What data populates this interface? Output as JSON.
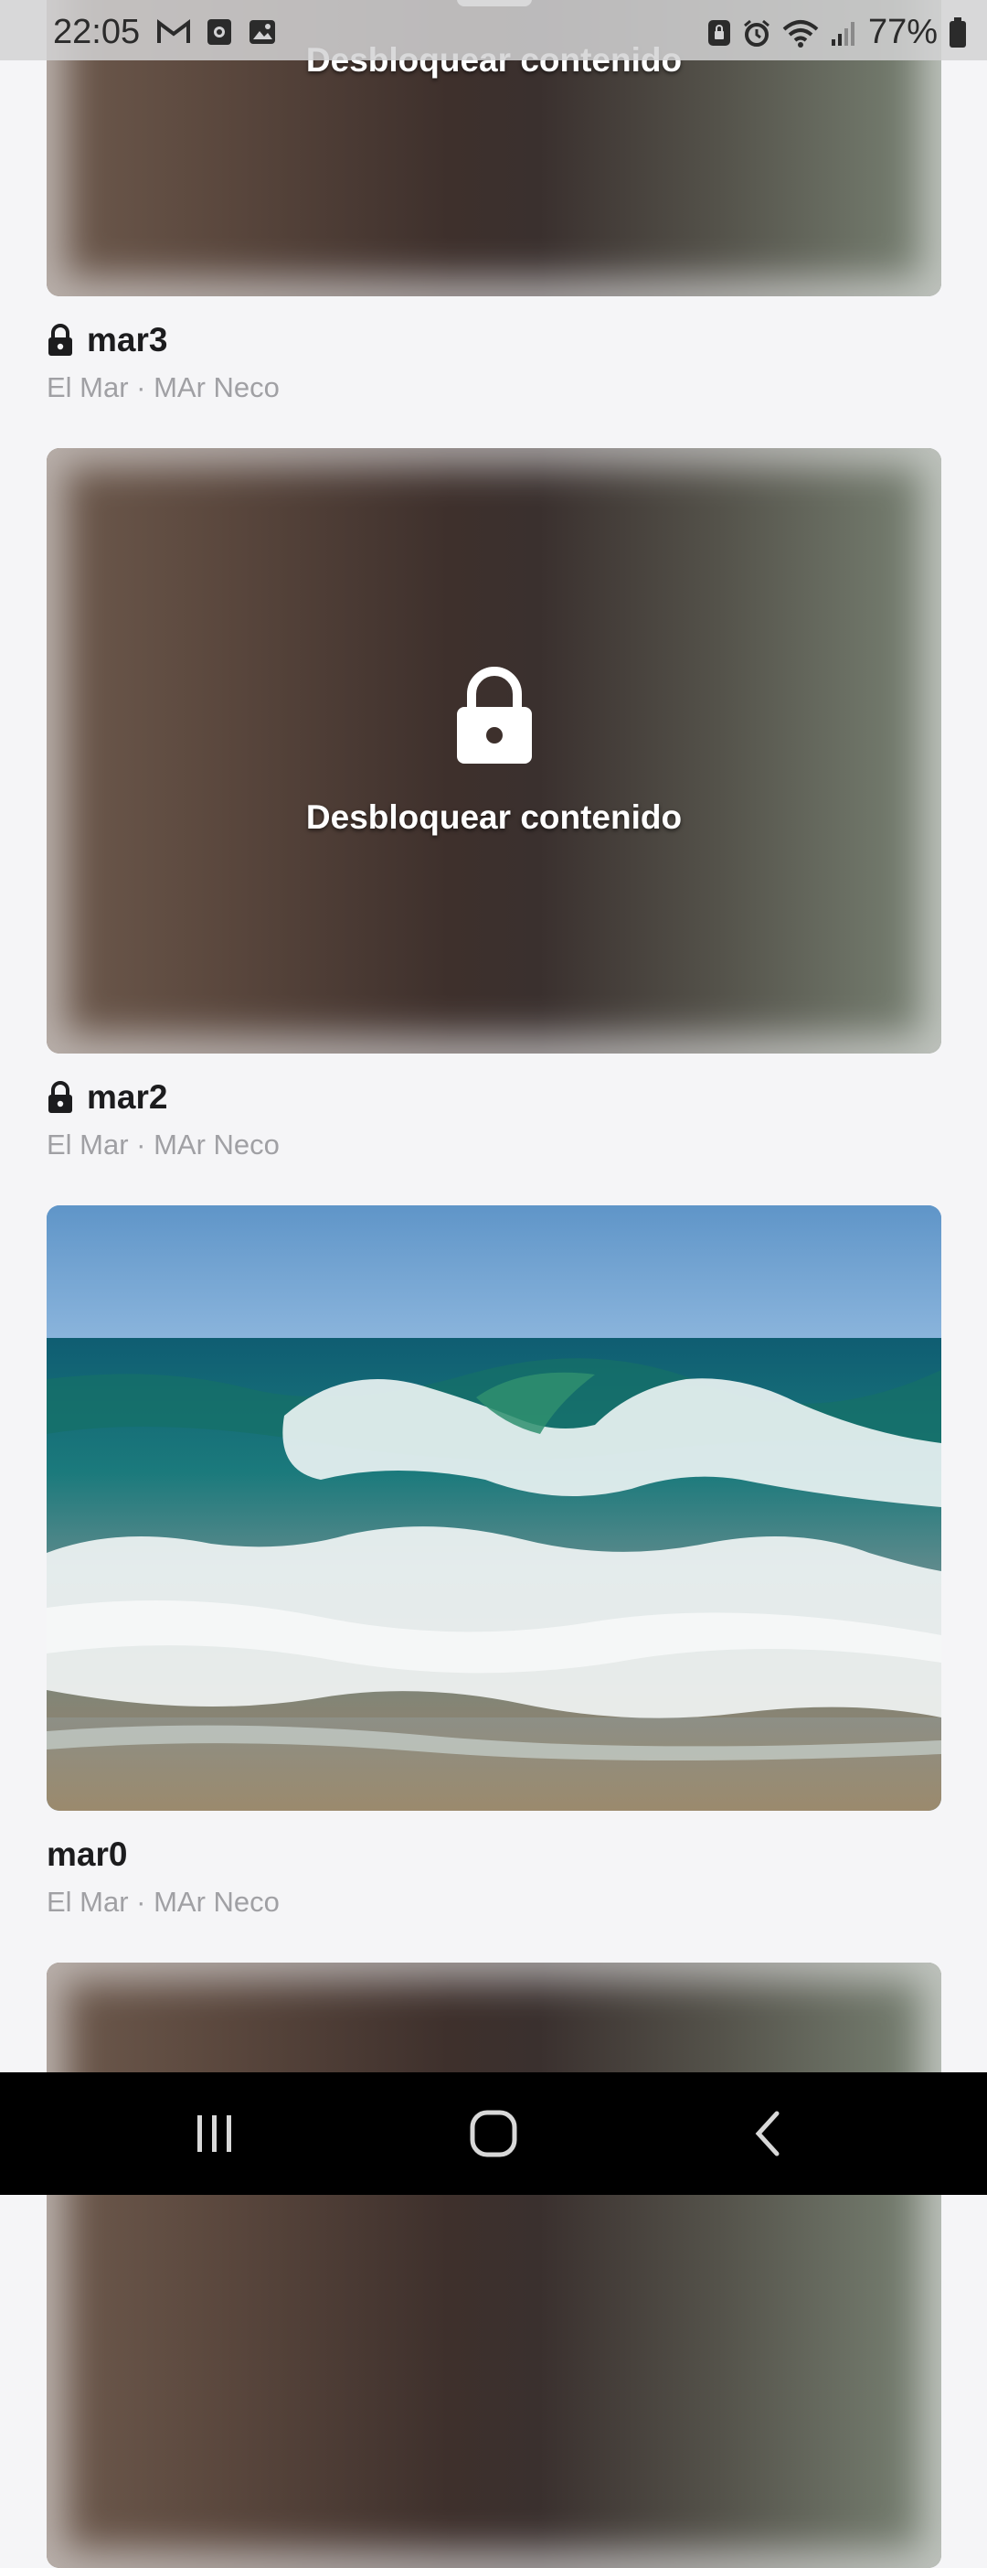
{
  "status_bar": {
    "time": "22:05",
    "battery": "77%",
    "left_icons": [
      "gmail-icon",
      "app-notification-icon",
      "gallery-icon"
    ],
    "right_icons": [
      "lock-app-icon",
      "alarm-icon",
      "wifi-icon",
      "signal-icon",
      "battery-icon"
    ]
  },
  "feed": {
    "unlock_label": "Desbloquear contenido",
    "posts": [
      {
        "title": "mar3",
        "subtitle": "El Mar · MAr Neco",
        "locked": true
      },
      {
        "title": "mar2",
        "subtitle": "El Mar · MAr Neco",
        "locked": true
      },
      {
        "title": "mar0",
        "subtitle": "El Mar · MAr Neco",
        "locked": false
      }
    ]
  },
  "nav": {
    "icons": [
      "recents-icon",
      "home-icon",
      "back-icon"
    ]
  }
}
